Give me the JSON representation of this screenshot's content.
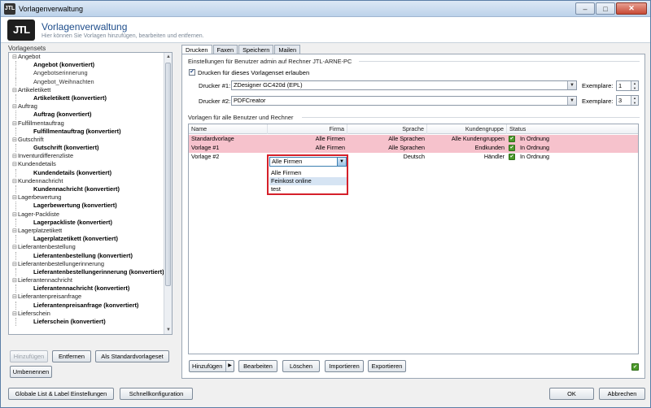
{
  "window": {
    "title": "Vorlagenverwaltung",
    "app_icon_text": "JTL"
  },
  "header": {
    "logo": "JTL",
    "title": "Vorlagenverwaltung",
    "subtitle": "Hier können Sie Vorlagen hinzufügen, bearbeiten und entfernen."
  },
  "left": {
    "label": "Vorlagensets",
    "tree": [
      {
        "type": "cat",
        "text": "Angebot"
      },
      {
        "type": "leaf",
        "text": "Angebot (konvertiert)",
        "bold": true
      },
      {
        "type": "leaf",
        "text": "Angebotserinnerung",
        "bold": false
      },
      {
        "type": "leaf",
        "text": "Angebot_Weihnachten",
        "bold": false
      },
      {
        "type": "cat",
        "text": "Artikeletikett"
      },
      {
        "type": "leaf",
        "text": "Artikeletikett (konvertiert)",
        "bold": true
      },
      {
        "type": "cat",
        "text": "Auftrag"
      },
      {
        "type": "leaf",
        "text": "Auftrag (konvertiert)",
        "bold": true
      },
      {
        "type": "cat",
        "text": "Fulfillmentauftrag"
      },
      {
        "type": "leaf",
        "text": "Fulfillmentauftrag (konvertiert)",
        "bold": true
      },
      {
        "type": "cat",
        "text": "Gutschrift"
      },
      {
        "type": "leaf",
        "text": "Gutschrift (konvertiert)",
        "bold": true
      },
      {
        "type": "cat",
        "text": "Inventurdifferenzliste"
      },
      {
        "type": "cat",
        "text": "Kundendetails"
      },
      {
        "type": "leaf",
        "text": "Kundendetails (konvertiert)",
        "bold": true
      },
      {
        "type": "cat",
        "text": "Kundennachricht"
      },
      {
        "type": "leaf",
        "text": "Kundennachricht (konvertiert)",
        "bold": true
      },
      {
        "type": "cat",
        "text": "Lagerbewertung"
      },
      {
        "type": "leaf",
        "text": "Lagerbewertung (konvertiert)",
        "bold": true
      },
      {
        "type": "cat",
        "text": "Lager-Packliste"
      },
      {
        "type": "leaf",
        "text": "Lagerpackliste (konvertiert)",
        "bold": true
      },
      {
        "type": "cat",
        "text": "Lagerplatzetikett"
      },
      {
        "type": "leaf",
        "text": "Lagerplatzetikett (konvertiert)",
        "bold": true
      },
      {
        "type": "cat",
        "text": "Lieferantenbestellung"
      },
      {
        "type": "leaf",
        "text": "Lieferantenbestellung (konvertiert)",
        "bold": true
      },
      {
        "type": "cat",
        "text": "Lieferantenbestellungerinnerung"
      },
      {
        "type": "leaf",
        "text": "Lieferantenbestellungerinnerung (konvertiert)",
        "bold": true
      },
      {
        "type": "cat",
        "text": "Lieferantennachricht"
      },
      {
        "type": "leaf",
        "text": "Lieferantennachricht (konvertiert)",
        "bold": true
      },
      {
        "type": "cat",
        "text": "Lieferantenpreisanfrage"
      },
      {
        "type": "leaf",
        "text": "Lieferantenpreisanfrage (konvertiert)",
        "bold": true
      },
      {
        "type": "cat",
        "text": "Lieferschein"
      },
      {
        "type": "leaf",
        "text": "Lieferschein (konvertiert)",
        "bold": true
      }
    ],
    "buttons": {
      "add": "Hinzufügen",
      "remove": "Entfernen",
      "set_default": "Als Standardvorlageset",
      "rename": "Umbenennen"
    }
  },
  "tabs": [
    "Drucken",
    "Faxen",
    "Speichern",
    "Mailen"
  ],
  "print": {
    "settings_label": "Einstellungen für Benutzer admin auf Rechner JTL-ARNE-PC",
    "allow_print_label": "Drucken für dieses Vorlagenset erlauben",
    "printer1_label": "Drucker #1:",
    "printer1_value": "ZDesigner GC420d (EPL)",
    "printer2_label": "Drucker #2:",
    "printer2_value": "PDFCreator",
    "copies_label": "Exemplare:",
    "copies1": "1",
    "copies2": "3",
    "templates_label": "Vorlagen für alle Benutzer und Rechner"
  },
  "grid": {
    "columns": [
      "Name",
      "Firma",
      "Sprache",
      "Kundengruppe",
      "Status"
    ],
    "rows": [
      {
        "name": "Standardvorlage",
        "firma": "Alle Firmen",
        "sprache": "Alle Sprachen",
        "gruppe": "Alle Kundengruppen",
        "status": "In Ordnung",
        "pink": true
      },
      {
        "name": "Vorlage #1",
        "firma": "Alle Firmen",
        "sprache": "Alle Sprachen",
        "gruppe": "Endkunden",
        "status": "In Ordnung",
        "pink": true
      },
      {
        "name": "Vorlage #2",
        "firma": "",
        "sprache": "Deutsch",
        "gruppe": "Händler",
        "status": "In Ordnung",
        "pink": false
      }
    ],
    "dropdown": {
      "selected": "Alle Firmen",
      "options": [
        "Alle Firmen",
        "Feinkost online",
        "test"
      ],
      "highlighted_index": 1
    }
  },
  "grid_buttons": {
    "add": "Hinzufügen",
    "edit": "Bearbeiten",
    "delete": "Löschen",
    "import": "Importieren",
    "export": "Exportieren"
  },
  "footer": {
    "global_settings": "Globale List & Label Einstellungen",
    "quick_config": "Schnellkonfiguration",
    "ok": "OK",
    "cancel": "Abbrechen"
  },
  "colors": {
    "pink_row": "#f6c2cc",
    "accent_title": "#1f4e8c",
    "highlight_border": "#d5202a",
    "ok_green": "#4c9a2a"
  }
}
